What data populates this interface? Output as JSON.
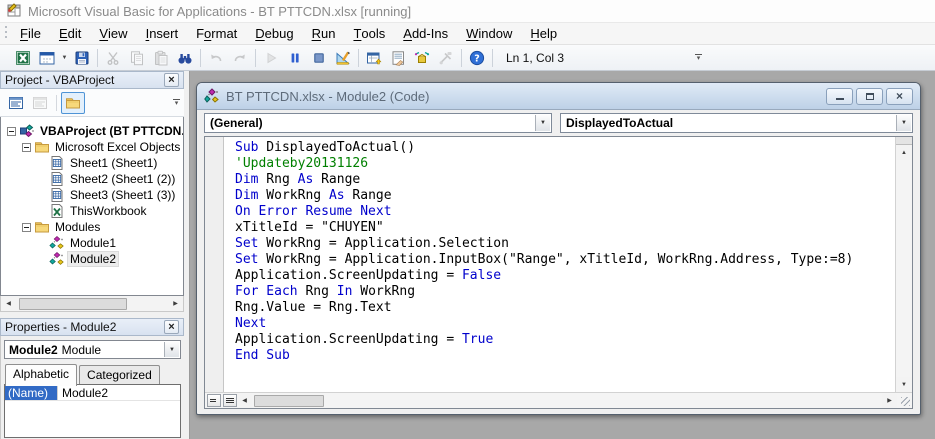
{
  "colors": {
    "keyword": "#0000cc",
    "comment": "#008000",
    "plain": "#000000",
    "mdi_background": "#a8a8a8",
    "title_text": "#8a8a8a",
    "codewin_titlebar": "#bdd1e7",
    "property_name_selected": "#316ac5"
  },
  "window": {
    "title": "Microsoft Visual Basic for Applications - BT PTTCDN.xlsx [running]",
    "menu": [
      {
        "label": "File",
        "u": 0
      },
      {
        "label": "Edit",
        "u": 0
      },
      {
        "label": "View",
        "u": 0
      },
      {
        "label": "Insert",
        "u": 0
      },
      {
        "label": "Format",
        "u": 1
      },
      {
        "label": "Debug",
        "u": 0
      },
      {
        "label": "Run",
        "u": 0
      },
      {
        "label": "Tools",
        "u": 0
      },
      {
        "label": "Add-Ins",
        "u": 0
      },
      {
        "label": "Window",
        "u": 0
      },
      {
        "label": "Help",
        "u": 0
      }
    ]
  },
  "toolbar": {
    "items": [
      {
        "type": "grip"
      },
      {
        "type": "btn",
        "name": "view-excel-button",
        "icon": "excel-icon"
      },
      {
        "type": "btn",
        "name": "insert-userform-button",
        "icon": "userform-icon",
        "caret": true
      },
      {
        "type": "btn",
        "name": "save-button",
        "icon": "save-icon"
      },
      {
        "type": "sep"
      },
      {
        "type": "btn",
        "name": "cut-button",
        "icon": "scissors-icon",
        "disabled": true
      },
      {
        "type": "btn",
        "name": "copy-button",
        "icon": "copy-icon",
        "disabled": true
      },
      {
        "type": "btn",
        "name": "paste-button",
        "icon": "paste-icon",
        "disabled": true
      },
      {
        "type": "btn",
        "name": "find-button",
        "icon": "binoculars-icon"
      },
      {
        "type": "sep"
      },
      {
        "type": "btn",
        "name": "undo-button",
        "icon": "undo-icon",
        "disabled": true
      },
      {
        "type": "btn",
        "name": "redo-button",
        "icon": "redo-icon",
        "disabled": true
      },
      {
        "type": "sep"
      },
      {
        "type": "btn",
        "name": "run-button",
        "icon": "run-icon",
        "disabled": true
      },
      {
        "type": "btn",
        "name": "break-button",
        "icon": "pause-icon"
      },
      {
        "type": "btn",
        "name": "reset-button",
        "icon": "stop-icon"
      },
      {
        "type": "btn",
        "name": "design-mode-button",
        "icon": "design-mode-icon"
      },
      {
        "type": "sep"
      },
      {
        "type": "btn",
        "name": "project-explorer-button",
        "icon": "project-explorer-icon"
      },
      {
        "type": "btn",
        "name": "properties-window-button",
        "icon": "properties-window-icon"
      },
      {
        "type": "btn",
        "name": "object-browser-button",
        "icon": "object-browser-icon"
      },
      {
        "type": "btn",
        "name": "toolbox-button",
        "icon": "toolbox-icon",
        "disabled": true
      },
      {
        "type": "sep"
      },
      {
        "type": "btn",
        "name": "help-button",
        "icon": "help-icon"
      },
      {
        "type": "sep"
      },
      {
        "type": "label",
        "name": "cursor-position",
        "text": "Ln 1, Col 3"
      },
      {
        "type": "overflow",
        "name": "toolbar-options-button"
      }
    ]
  },
  "project_panel": {
    "title": "Project - VBAProject",
    "toolbar": [
      {
        "name": "view-code-button",
        "icon": "view-code-icon"
      },
      {
        "name": "view-object-button",
        "icon": "view-object-icon",
        "disabled": true
      },
      {
        "sep": true
      },
      {
        "name": "toggle-folders-button",
        "icon": "folder-icon",
        "active": true
      }
    ],
    "tree": [
      {
        "depth": 0,
        "icon": "vbaproject-icon",
        "label": "VBAProject (BT PTTCDN.xlsx)",
        "bold": true,
        "toggle": true
      },
      {
        "depth": 1,
        "icon": "folder-icon",
        "label": "Microsoft Excel Objects",
        "toggle": true
      },
      {
        "depth": 2,
        "icon": "worksheet-icon",
        "label": "Sheet1 (Sheet1)"
      },
      {
        "depth": 2,
        "icon": "worksheet-icon",
        "label": "Sheet2 (Sheet1 (2))"
      },
      {
        "depth": 2,
        "icon": "worksheet-icon",
        "label": "Sheet3 (Sheet1 (3))"
      },
      {
        "depth": 2,
        "icon": "workbook-icon",
        "label": "ThisWorkbook"
      },
      {
        "depth": 1,
        "icon": "folder-icon",
        "label": "Modules",
        "toggle": true
      },
      {
        "depth": 2,
        "icon": "module-icon",
        "label": "Module1"
      },
      {
        "depth": 2,
        "icon": "module-icon",
        "label": "Module2",
        "selected": true
      }
    ]
  },
  "properties_panel": {
    "title": "Properties - Module2",
    "object_name": "Module2",
    "object_type": "Module",
    "tabs": [
      "Alphabetic",
      "Categorized"
    ],
    "rows": [
      {
        "name": "(Name)",
        "value": "Module2"
      }
    ]
  },
  "code_window": {
    "title": "BT PTTCDN.xlsx - Module2 (Code)",
    "object_dropdown": "(General)",
    "procedure_dropdown": "DisplayedToActual",
    "lines": [
      [
        [
          "k",
          "Sub"
        ],
        [
          "p",
          " DisplayedToActual()"
        ]
      ],
      [
        [
          "c",
          "'Updateby20131126"
        ]
      ],
      [
        [
          "k",
          "Dim"
        ],
        [
          "p",
          " Rng "
        ],
        [
          "k",
          "As"
        ],
        [
          "p",
          " Range"
        ]
      ],
      [
        [
          "k",
          "Dim"
        ],
        [
          "p",
          " WorkRng "
        ],
        [
          "k",
          "As"
        ],
        [
          "p",
          " Range"
        ]
      ],
      [
        [
          "k",
          "On Error Resume Next"
        ]
      ],
      [
        [
          "p",
          "xTitleId = \"CHUYEN\""
        ]
      ],
      [
        [
          "k",
          "Set"
        ],
        [
          "p",
          " WorkRng = Application.Selection"
        ]
      ],
      [
        [
          "k",
          "Set"
        ],
        [
          "p",
          " WorkRng = Application.InputBox(\"Range\", xTitleId, WorkRng.Address, Type:=8)"
        ]
      ],
      [
        [
          "p",
          "Application.ScreenUpdating = "
        ],
        [
          "k",
          "False"
        ]
      ],
      [
        [
          "k",
          "For Each"
        ],
        [
          "p",
          " Rng "
        ],
        [
          "k",
          "In"
        ],
        [
          "p",
          " WorkRng"
        ]
      ],
      [
        [
          "p",
          "Rng.Value = Rng.Text"
        ]
      ],
      [
        [
          "k",
          "Next"
        ]
      ],
      [
        [
          "p",
          "Application.ScreenUpdating = "
        ],
        [
          "k",
          "True"
        ]
      ],
      [
        [
          "k",
          "End Sub"
        ]
      ]
    ]
  }
}
